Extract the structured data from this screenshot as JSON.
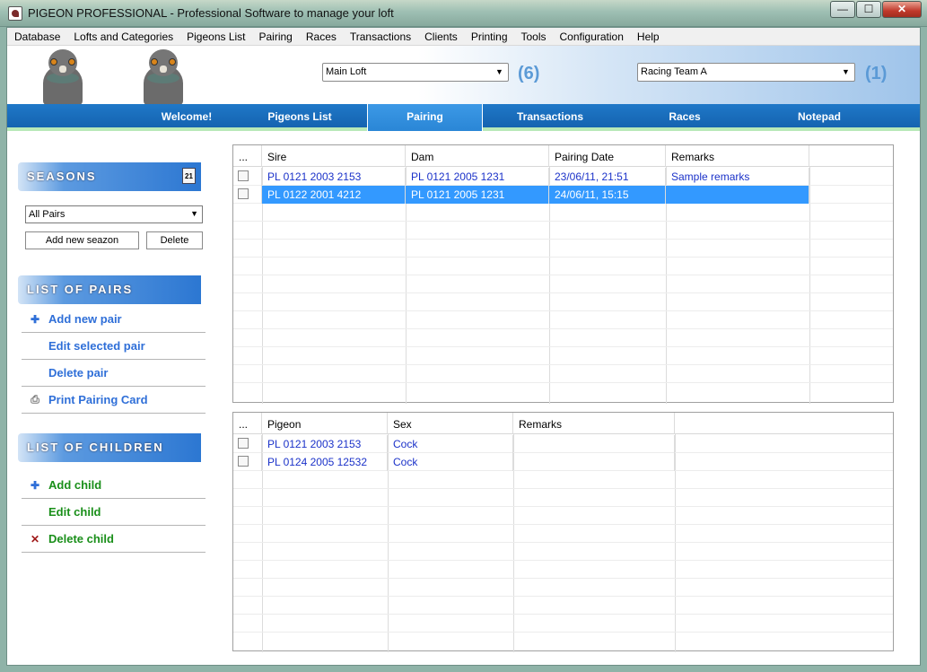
{
  "window": {
    "title": "PIGEON PROFESSIONAL - Professional Software to manage your loft",
    "min": "—",
    "max": "☐",
    "close": "✕"
  },
  "menu": [
    "Database",
    "Lofts and Categories",
    "Pigeons List",
    "Pairing",
    "Races",
    "Transactions",
    "Clients",
    "Printing",
    "Tools",
    "Configuration",
    "Help"
  ],
  "header": {
    "loft": "Main Loft",
    "loft_count": "(6)",
    "team": "Racing Team A",
    "team_count": "(1)"
  },
  "tabs": [
    "Welcome!",
    "Pigeons List",
    "Pairing",
    "Transactions",
    "Races",
    "Notepad"
  ],
  "active_tab": "Pairing",
  "seasons": {
    "title": "SEASONS",
    "calendar_icon": "21",
    "filter": "All Pairs",
    "add_btn": "Add new seazon",
    "delete_btn": "Delete"
  },
  "pairs": {
    "title": "LIST OF PAIRS",
    "add": "Add new pair",
    "edit": "Edit selected pair",
    "delete": "Delete pair",
    "print": "Print Pairing Card"
  },
  "children": {
    "title": "LIST OF CHILDREN",
    "add": "Add child",
    "edit": "Edit child",
    "delete": "Delete child"
  },
  "pairs_table": {
    "columns": [
      "...",
      "Sire",
      "Dam",
      "Pairing Date",
      "Remarks"
    ],
    "rows": [
      {
        "sire": "PL 0121 2003 2153",
        "dam": "PL 0121 2005 1231",
        "date": "23/06/11, 21:51",
        "remarks": "Sample remarks"
      },
      {
        "sire": "PL 0122 2001 4212",
        "dam": "PL 0121 2005 1231",
        "date": "24/06/11, 15:15",
        "remarks": ""
      }
    ]
  },
  "children_table": {
    "columns": [
      "...",
      "Pigeon",
      "Sex",
      "Remarks"
    ],
    "rows": [
      {
        "pigeon": "PL 0121 2003 2153",
        "sex": "Cock",
        "remarks": ""
      },
      {
        "pigeon": "PL 0124 2005 12532",
        "sex": "Cock",
        "remarks": ""
      }
    ]
  }
}
